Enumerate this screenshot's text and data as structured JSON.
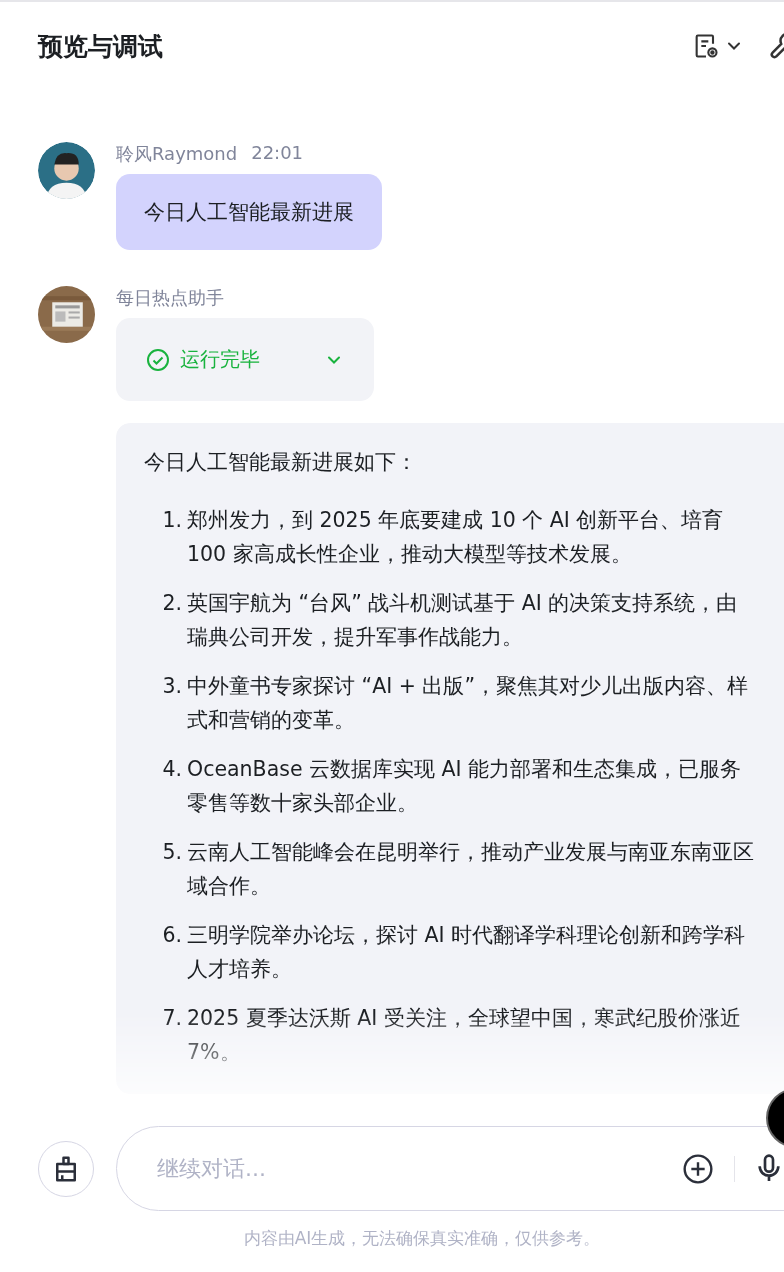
{
  "header": {
    "title": "预览与调试"
  },
  "messages": [
    {
      "kind": "user",
      "author": "聆风Raymond",
      "time": "22:01",
      "text": "今日人工智能最新进展"
    },
    {
      "kind": "assistant",
      "author": "每日热点助手",
      "status": {
        "label": "运行完毕",
        "expanded": false
      },
      "intro": "今日人工智能最新进展如下：",
      "items": [
        {
          "number": "1.",
          "text": "郑州发力，到 2025 年底要建成 10 个 AI 创新平台、培育 100 家高成长性企业，推动大模型等技术发展。"
        },
        {
          "number": "2.",
          "text": "英国宇航为 “台风” 战斗机测试基于 AI 的决策支持系统，由瑞典公司开发，提升军事作战能力。"
        },
        {
          "number": "3.",
          "text": "中外童书专家探讨 “AI + 出版”，聚焦其对少儿出版内容、样式和营销的变革。"
        },
        {
          "number": "4.",
          "text": "OceanBase 云数据库实现 AI 能力部署和生态集成，已服务零售等数十家头部企业。"
        },
        {
          "number": "5.",
          "text": "云南人工智能峰会在昆明举行，推动产业发展与南亚东南亚区域合作。"
        },
        {
          "number": "6.",
          "text": "三明学院举办论坛，探讨 AI 时代翻译学科理论创新和跨学科人才培养。"
        },
        {
          "number": "7.",
          "text": "2025 夏季达沃斯 AI 受关注，全球望中国，寒武纪股价涨近 7%。"
        }
      ]
    }
  ],
  "input": {
    "placeholder": "继续对话..."
  },
  "footer": "内容由AI生成，无法确保真实准确，仅供参考。"
}
